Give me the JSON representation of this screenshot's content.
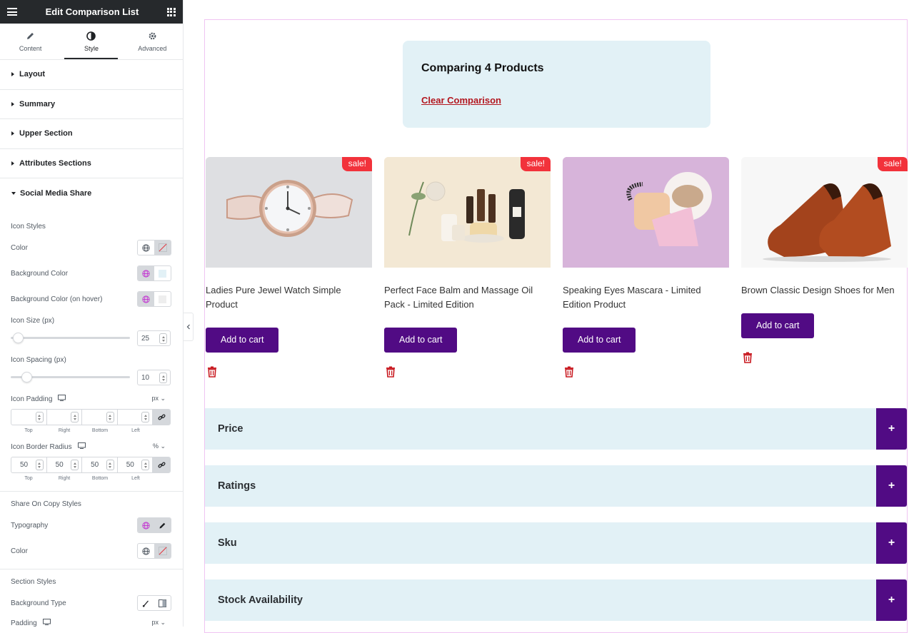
{
  "sidebar": {
    "title": "Edit Comparison List",
    "tabs": [
      {
        "label": "Content",
        "icon": "pencil-icon",
        "active": false
      },
      {
        "label": "Style",
        "icon": "contrast-icon",
        "active": true
      },
      {
        "label": "Advanced",
        "icon": "gear-icon",
        "active": false
      }
    ],
    "sections": [
      "Layout",
      "Summary",
      "Upper Section",
      "Attributes Sections"
    ],
    "open_section": "Social Media Share",
    "icon_styles": {
      "heading": "Icon Styles",
      "color_label": "Color",
      "bg_color_label": "Background Color",
      "bg_hover_label": "Background Color (on hover)",
      "icon_size_label": "Icon Size (px)",
      "icon_size_value": "25",
      "icon_size_level": 0.02,
      "icon_spacing_label": "Icon Spacing (px)",
      "icon_spacing_value": "10",
      "icon_spacing_level": 0.1,
      "padding_label": "Icon Padding",
      "padding_unit": "px",
      "padding_values": [
        "",
        "",
        "",
        ""
      ],
      "dim_labels": [
        "Top",
        "Right",
        "Bottom",
        "Left"
      ],
      "radius_label": "Icon Border Radius",
      "radius_unit": "%",
      "radius_values": [
        "50",
        "50",
        "50",
        "50"
      ]
    },
    "share_copy": {
      "heading": "Share On Copy Styles",
      "typography_label": "Typography",
      "color_label": "Color"
    },
    "section_styles": {
      "heading": "Section Styles",
      "bg_type_label": "Background Type",
      "padding_label": "Padding",
      "padding_unit": "px"
    }
  },
  "summary": {
    "heading": "Comparing 4 Products",
    "clear_label": "Clear Comparison"
  },
  "products": [
    {
      "name": "Ladies Pure Jewel Watch Simple Product",
      "badge": "sale!",
      "button": "Add to cart"
    },
    {
      "name": "Perfect Face Balm and Massage Oil Pack - Limited Edition",
      "badge": "sale!",
      "button": "Add to cart"
    },
    {
      "name": "Speaking Eyes Mascara - Limited Edition Product",
      "badge": "",
      "button": "Add to cart"
    },
    {
      "name": "Brown Classic Design Shoes for Men",
      "badge": "sale!",
      "button": "Add to cart"
    }
  ],
  "attributes": [
    {
      "label": "Price",
      "toggle": "+"
    },
    {
      "label": "Ratings",
      "toggle": "+"
    },
    {
      "label": "Sku",
      "toggle": "+"
    },
    {
      "label": "Stock Availability",
      "toggle": "+"
    }
  ],
  "colors": {
    "accent": "#510b84",
    "sale": "#f2323b",
    "link": "#b3171f",
    "panel_bg": "#e2f1f6",
    "global_icon": "#c33ad1"
  }
}
